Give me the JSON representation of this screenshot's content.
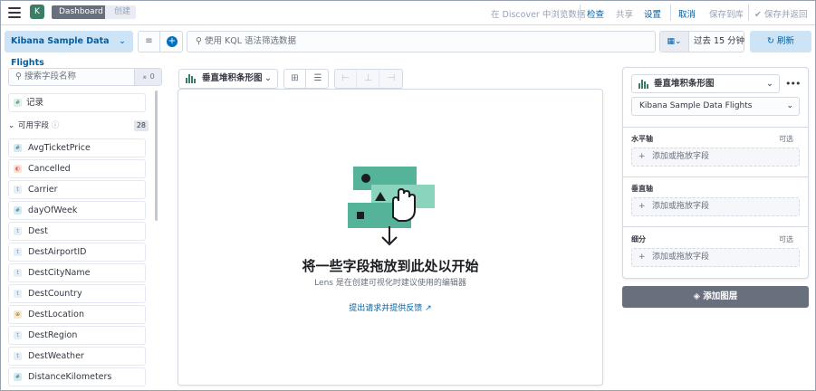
{
  "topbar": {
    "logo_text": "K",
    "breadcrumbs": [
      "Dashboard",
      "创建"
    ],
    "nav": {
      "discover": "在 Discover 中浏览数据",
      "inspect": "检查",
      "share": "共享",
      "settings": "设置",
      "cancel": "取消",
      "save_to_library": "保存到库",
      "save_and_return": "保存并返回"
    }
  },
  "querybar": {
    "data_view": "Kibana Sample Data Flights",
    "query_placeholder": "使用 KQL 语法筛选数据",
    "time_range": "过去 15 分钟",
    "refresh_label": "刷新"
  },
  "field_list": {
    "search_placeholder": "搜索字段名称",
    "filter_count": "0",
    "records_label": "记录",
    "section_label": "可用字段",
    "section_count": "28",
    "fields": [
      {
        "name": "AvgTicketPrice",
        "type": "number",
        "glyph": "#"
      },
      {
        "name": "Cancelled",
        "type": "boolean",
        "glyph": "◐"
      },
      {
        "name": "Carrier",
        "type": "keyword",
        "glyph": "t"
      },
      {
        "name": "dayOfWeek",
        "type": "number",
        "glyph": "#"
      },
      {
        "name": "Dest",
        "type": "keyword",
        "glyph": "t"
      },
      {
        "name": "DestAirportID",
        "type": "keyword",
        "glyph": "t"
      },
      {
        "name": "DestCityName",
        "type": "keyword",
        "glyph": "t"
      },
      {
        "name": "DestCountry",
        "type": "keyword",
        "glyph": "t"
      },
      {
        "name": "DestLocation",
        "type": "geo_point",
        "glyph": "⊕"
      },
      {
        "name": "DestRegion",
        "type": "keyword",
        "glyph": "t"
      },
      {
        "name": "DestWeather",
        "type": "keyword",
        "glyph": "t"
      },
      {
        "name": "DistanceKilometers",
        "type": "number",
        "glyph": "#"
      }
    ]
  },
  "workspace": {
    "chart_type": "垂直堆积条形图",
    "empty_title": "将一些字段拖放到此处以开始",
    "empty_subtitle": "Lens 是在创建可视化时建议使用的编辑器",
    "feedback_link": "提出请求并提供反馈 ↗"
  },
  "config_panel": {
    "chart_type": "垂直堆积条形图",
    "data_view": "Kibana Sample Data Flights",
    "sections": [
      {
        "label": "水平轴",
        "optional": "可选",
        "drop_hint": "添加或拖放字段"
      },
      {
        "label": "垂直轴",
        "optional": "",
        "drop_hint": "添加或拖放字段"
      },
      {
        "label": "细分",
        "optional": "可选",
        "drop_hint": "添加或拖放字段"
      }
    ],
    "add_layer": "添加图层"
  },
  "colors": {
    "accent": "#0071c2",
    "brand_green": "#3c7d68",
    "illustration_green": "#54b399"
  }
}
